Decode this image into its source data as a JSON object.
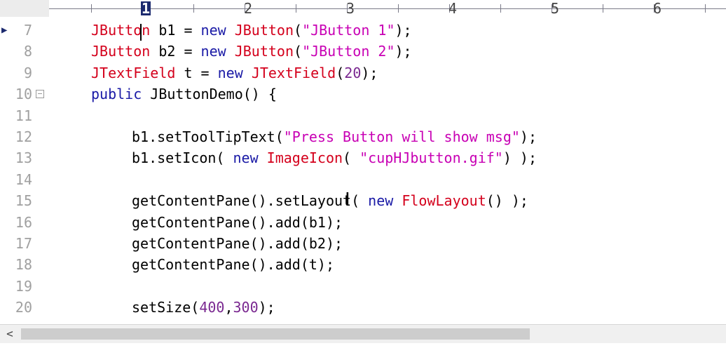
{
  "ruler": {
    "marks": [
      "1",
      "2",
      "3",
      "4",
      "5",
      "6"
    ],
    "active_mark": "1"
  },
  "lines": [
    {
      "n": "7",
      "tokens": [
        [
          "type",
          "JButton"
        ],
        [
          "",
          " b1 = "
        ],
        [
          "kw",
          "new"
        ],
        [
          "",
          " "
        ],
        [
          "type",
          "JButton"
        ],
        [
          "",
          "("
        ],
        [
          "str",
          "\"JButton 1\""
        ],
        [
          "",
          ");"
        ]
      ]
    },
    {
      "n": "8",
      "tokens": [
        [
          "type",
          "JButton"
        ],
        [
          "",
          " b2 = "
        ],
        [
          "kw",
          "new"
        ],
        [
          "",
          " "
        ],
        [
          "type",
          "JButton"
        ],
        [
          "",
          "("
        ],
        [
          "str",
          "\"JButton 2\""
        ],
        [
          "",
          ");"
        ]
      ]
    },
    {
      "n": "9",
      "tokens": [
        [
          "type",
          "JTextField"
        ],
        [
          "",
          " t = "
        ],
        [
          "kw",
          "new"
        ],
        [
          "",
          " "
        ],
        [
          "type",
          "JTextField"
        ],
        [
          "",
          "("
        ],
        [
          "num",
          "20"
        ],
        [
          "",
          ");"
        ]
      ]
    },
    {
      "n": "10",
      "tokens": [
        [
          "kw",
          "public"
        ],
        [
          "",
          " JButtonDemo() {"
        ]
      ]
    },
    {
      "n": "11",
      "tokens": []
    },
    {
      "n": "12",
      "tokens": [
        [
          "",
          "b1.setToolTipText("
        ],
        [
          "str",
          "\"Press Button will show msg\""
        ],
        [
          "",
          ");"
        ]
      ]
    },
    {
      "n": "13",
      "tokens": [
        [
          "",
          "b1.setIcon( "
        ],
        [
          "kw",
          "new"
        ],
        [
          "",
          " "
        ],
        [
          "type",
          "ImageIcon"
        ],
        [
          "",
          "( "
        ],
        [
          "str",
          "\"cupHJbutton.gif\""
        ],
        [
          "",
          ") );"
        ]
      ]
    },
    {
      "n": "14",
      "tokens": []
    },
    {
      "n": "15",
      "tokens": [
        [
          "",
          "getContentPane().setLayout( "
        ],
        [
          "kw",
          "new"
        ],
        [
          "",
          " "
        ],
        [
          "type",
          "FlowLayout"
        ],
        [
          "",
          "() );"
        ]
      ]
    },
    {
      "n": "16",
      "tokens": [
        [
          "",
          "getContentPane().add(b1);"
        ]
      ]
    },
    {
      "n": "17",
      "tokens": [
        [
          "",
          "getContentPane().add(b2);"
        ]
      ]
    },
    {
      "n": "18",
      "tokens": [
        [
          "",
          "getContentPane().add(t);"
        ]
      ]
    },
    {
      "n": "19",
      "tokens": []
    },
    {
      "n": "20",
      "tokens": [
        [
          "",
          "setSize("
        ],
        [
          "num",
          "400"
        ],
        [
          "",
          ","
        ],
        [
          "num",
          "300"
        ],
        [
          "",
          ");"
        ]
      ]
    }
  ],
  "scroll": {
    "left_arrow": "<"
  },
  "icons": {
    "current_line_marker": "triangle-right-icon",
    "fold": "fold-minus-icon"
  },
  "colors": {
    "keyword": "#1a1aa6",
    "type": "#d4001c",
    "string": "#c800b4",
    "number": "#7a2890",
    "ruler_active": "#1c2a6e"
  }
}
